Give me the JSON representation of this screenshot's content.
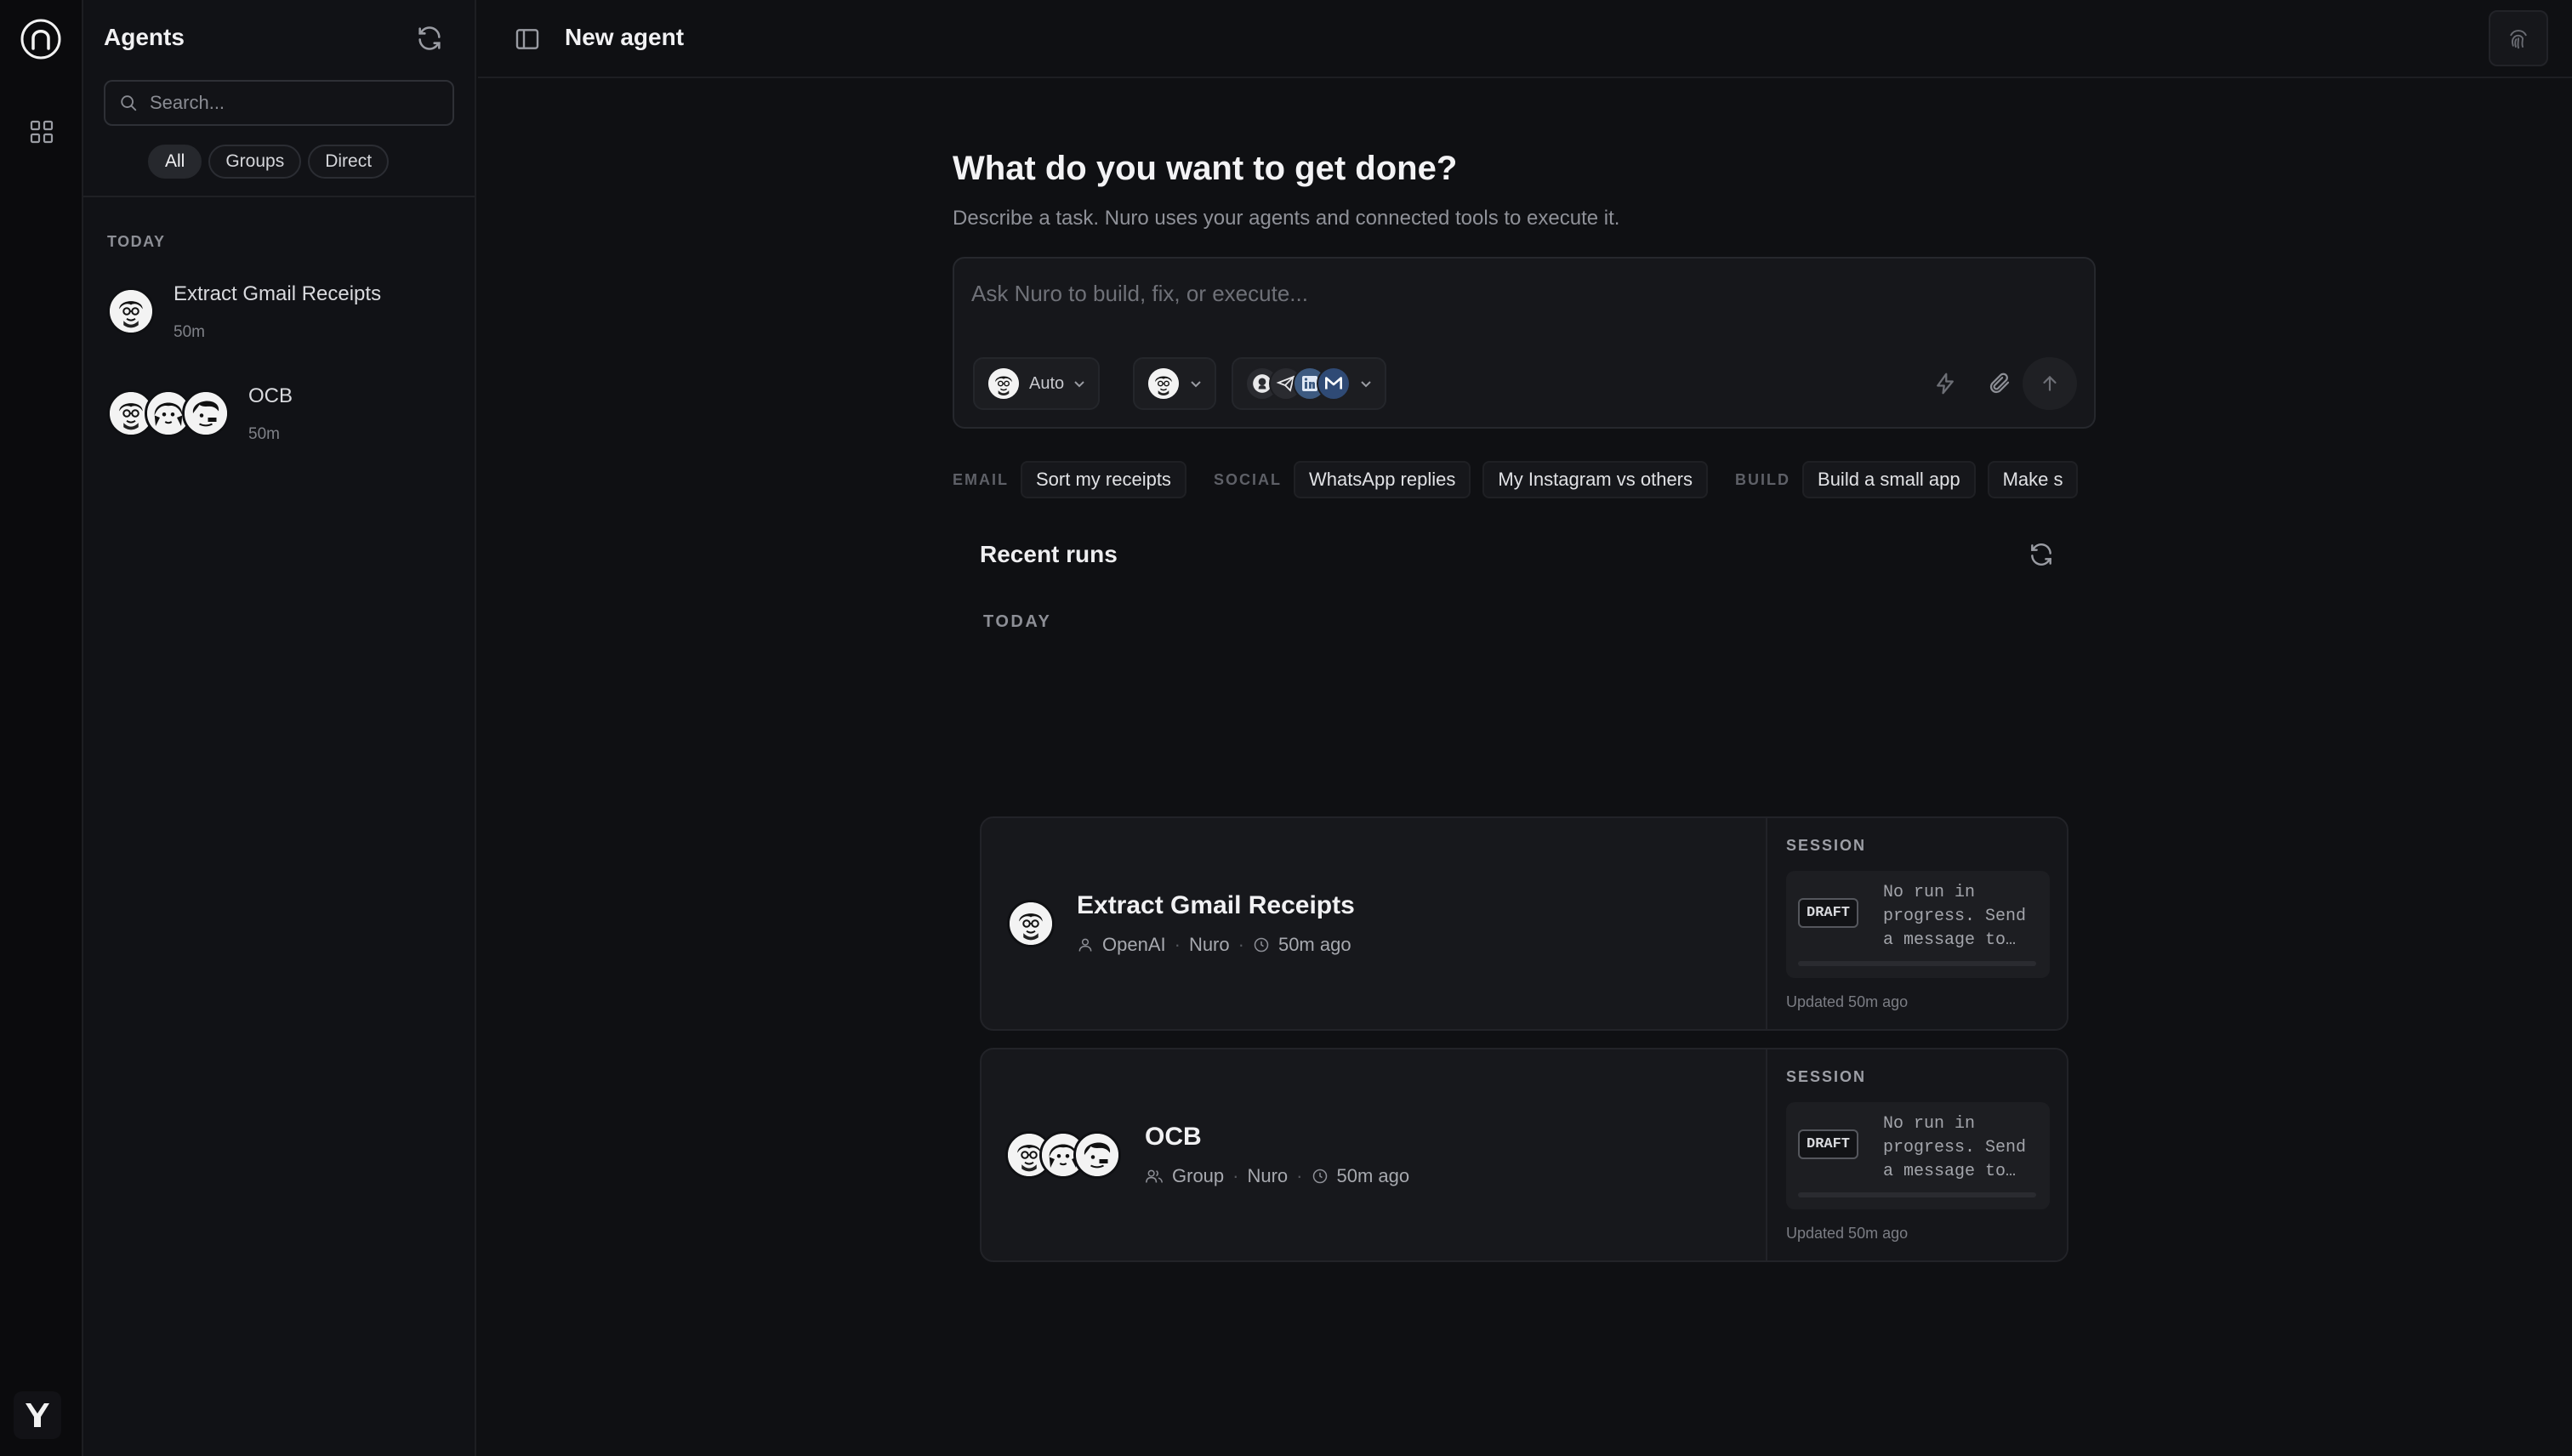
{
  "sidebar": {
    "title": "Agents",
    "search_placeholder": "Search...",
    "filters": [
      "All",
      "Groups",
      "Direct"
    ],
    "section": "TODAY",
    "items": [
      {
        "name": "Extract Gmail Receipts",
        "time": "50m"
      },
      {
        "name": "OCB",
        "time": "50m"
      }
    ]
  },
  "topbar": {
    "title": "New agent"
  },
  "main": {
    "heading": "What do you want to get done?",
    "subheading": "Describe a task. Nuro uses your agents and connected tools to execute it.",
    "composer_placeholder": "Ask Nuro to build, fix, or execute...",
    "model_label": "Auto"
  },
  "suggestions": [
    {
      "category": "EMAIL",
      "items": [
        "Sort my receipts"
      ]
    },
    {
      "category": "SOCIAL",
      "items": [
        "WhatsApp replies",
        "My Instagram vs others"
      ]
    },
    {
      "category": "BUILD",
      "items": [
        "Build a small app",
        "Make s"
      ]
    }
  ],
  "recent": {
    "title": "Recent runs",
    "section": "TODAY",
    "runs": [
      {
        "name": "Extract Gmail Receipts",
        "owner": "OpenAI",
        "agent": "Nuro",
        "time": "50m ago",
        "session_label": "SESSION",
        "status": "DRAFT",
        "session_text": "No run in progress. Send a message to…",
        "updated": "Updated 50m ago"
      },
      {
        "name": "OCB",
        "owner": "Group",
        "agent": "Nuro",
        "time": "50m ago",
        "session_label": "SESSION",
        "status": "DRAFT",
        "session_text": "No run in progress. Send a message to…",
        "updated": "Updated 50m ago"
      }
    ]
  },
  "colors": {
    "background": "#0f1013",
    "panel": "#16171b",
    "border": "#26282d",
    "text": "#e8e8ea",
    "muted": "#8f9198"
  },
  "icons": [
    "nuro-logo-icon",
    "grid-icon",
    "refresh-icon",
    "search-icon",
    "sidebar-panel-icon",
    "fingerprint-icon",
    "chevron-down-icon",
    "bolt-icon",
    "paperclip-icon",
    "arrow-up-icon",
    "user-icon",
    "group-icon",
    "clock-icon",
    "brand-icon"
  ]
}
